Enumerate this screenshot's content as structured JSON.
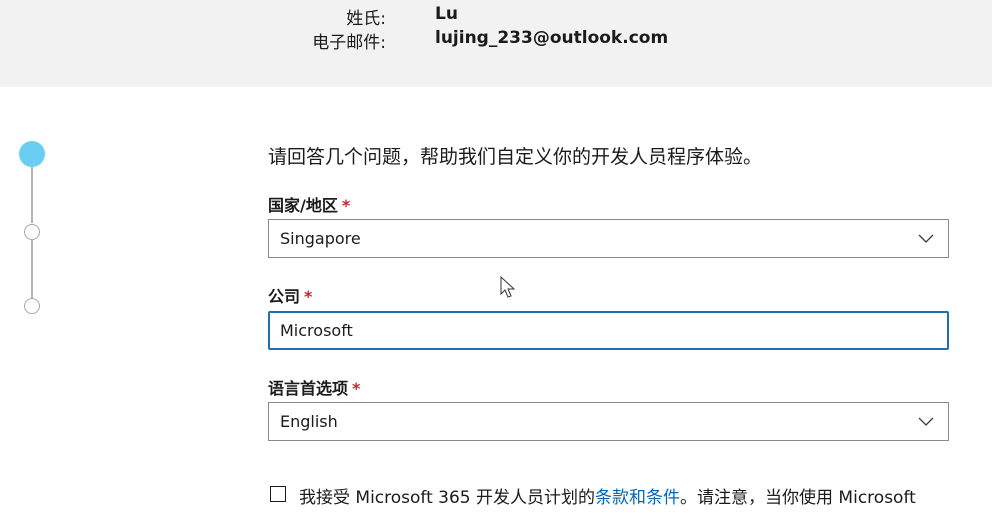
{
  "summary": {
    "surname_label": "姓氏:",
    "surname_value": "Lu",
    "email_label": "电子邮件:",
    "email_value": "lujing_233@outlook.com"
  },
  "stepper": {
    "steps": [
      {
        "state": "active"
      },
      {
        "state": "pending"
      },
      {
        "state": "pending"
      }
    ]
  },
  "form": {
    "intro": "请回答几个问题，帮助我们自定义你的开发人员程序体验。",
    "country": {
      "label": "国家/地区",
      "required_mark": "*",
      "value": "Singapore",
      "icon": "chevron-down-icon"
    },
    "company": {
      "label": "公司",
      "required_mark": "*",
      "value": "Microsoft"
    },
    "language": {
      "label": "语言首选项",
      "required_mark": "*",
      "value": "English",
      "icon": "chevron-down-icon"
    }
  },
  "consent": {
    "text_before": "我接受 Microsoft 365 开发人员计划的",
    "link": "条款和条件",
    "text_after": "。请注意，当你使用 Microsoft"
  },
  "colors": {
    "summary_bg": "#f2f2f2",
    "active_step": "#6ccdf3",
    "required": "#c4262e",
    "focus_border": "#1f6fb2",
    "link": "#0067b8"
  }
}
